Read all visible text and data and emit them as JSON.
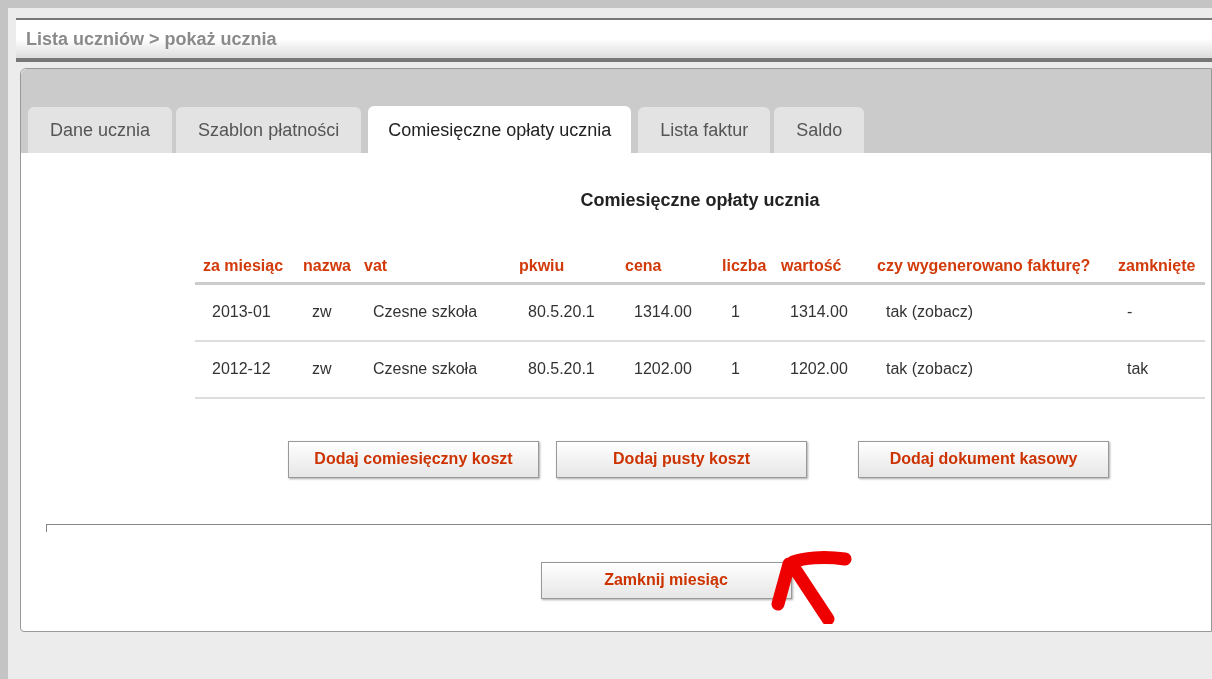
{
  "breadcrumb": "Lista uczniów > pokaż ucznia",
  "tabs": [
    {
      "label": "Dane ucznia",
      "selected": false
    },
    {
      "label": "Szablon płatności",
      "selected": false
    },
    {
      "label": "Comiesięczne opłaty ucznia",
      "selected": true
    },
    {
      "label": "Lista faktur",
      "selected": false
    },
    {
      "label": "Saldo",
      "selected": false
    }
  ],
  "section_title": "Comiesięczne opłaty ucznia",
  "table": {
    "columns": [
      "za miesiąc",
      "nazwa",
      "vat",
      "pkwiu",
      "cena",
      "liczba",
      "wartość",
      "czy wygenerowano fakturę?",
      "zamknięte"
    ],
    "rows": [
      [
        "2013-01",
        "zw",
        "Czesne szkoła",
        "80.5.20.1",
        "1314.00",
        "1",
        "1314.00",
        "tak (zobacz)",
        "-"
      ],
      [
        "2012-12",
        "zw",
        "Czesne szkoła",
        "80.5.20.1",
        "1202.00",
        "1",
        "1202.00",
        "tak (zobacz)",
        "tak"
      ]
    ]
  },
  "actions": [
    "Dodaj comiesięczny koszt",
    "Dodaj pusty koszt",
    "Dodaj dokument kasowy"
  ],
  "close_button": "Zamknij miesiąc"
}
